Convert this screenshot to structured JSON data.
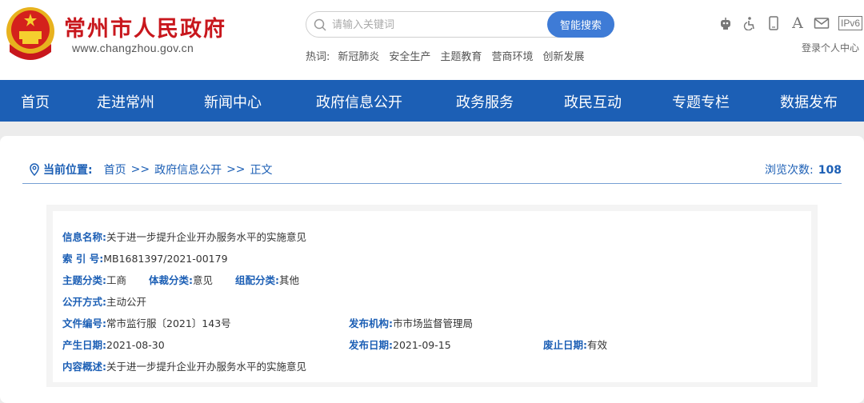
{
  "header": {
    "site_title": "常州市人民政府",
    "site_url": "www.changzhou.gov.cn",
    "search": {
      "placeholder": "请输入关键词",
      "button_label": "智能搜索"
    },
    "hot": {
      "label": "热词:",
      "items": [
        "新冠肺炎",
        "安全生产",
        "主题教育",
        "营商环境",
        "创新发展"
      ]
    },
    "tools": [
      "robot-icon",
      "accessibility-icon",
      "mobile-icon",
      "font-size-icon",
      "mail-icon",
      "ipv6-icon"
    ],
    "ipv6_label": "IPv6",
    "font_label": "A",
    "login_label": "登录个人中心"
  },
  "nav": {
    "items": [
      "首页",
      "走进常州",
      "新闻中心",
      "政府信息公开",
      "政务服务",
      "政民互动",
      "专题专栏",
      "数据发布"
    ]
  },
  "breadcrumb": {
    "label": "当前位置:",
    "items": [
      "首页",
      "政府信息公开",
      "正文"
    ],
    "separator": ">>"
  },
  "views": {
    "label": "浏览次数:",
    "count": "108"
  },
  "info": {
    "name_key": "信息名称:",
    "name_val": "关于进一步提升企业开办服务水平的实施意见",
    "index_key": "索 引 号:",
    "index_val": "MB1681397/2021-00179",
    "theme_key": "主题分类:",
    "theme_val": "工商",
    "genre_key": "体裁分类:",
    "genre_val": "意见",
    "org_type_key": "组配分类:",
    "org_type_val": "其他",
    "open_key": "公开方式:",
    "open_val": "主动公开",
    "doc_key": "文件编号:",
    "doc_val": "常市监行服〔2021〕143号",
    "publisher_key": "发布机构:",
    "publisher_val": "市市场监督管理局",
    "created_key": "产生日期:",
    "created_val": "2021-08-30",
    "published_key": "发布日期:",
    "published_val": "2021-09-15",
    "expire_key": "废止日期:",
    "expire_val": "有效",
    "summary_key": "内容概述:",
    "summary_val": "关于进一步提升企业开办服务水平的实施意见"
  },
  "colors": {
    "brand_red": "#c8171d",
    "nav_blue": "#1c5fb5",
    "search_blue": "#3e7bd6"
  }
}
